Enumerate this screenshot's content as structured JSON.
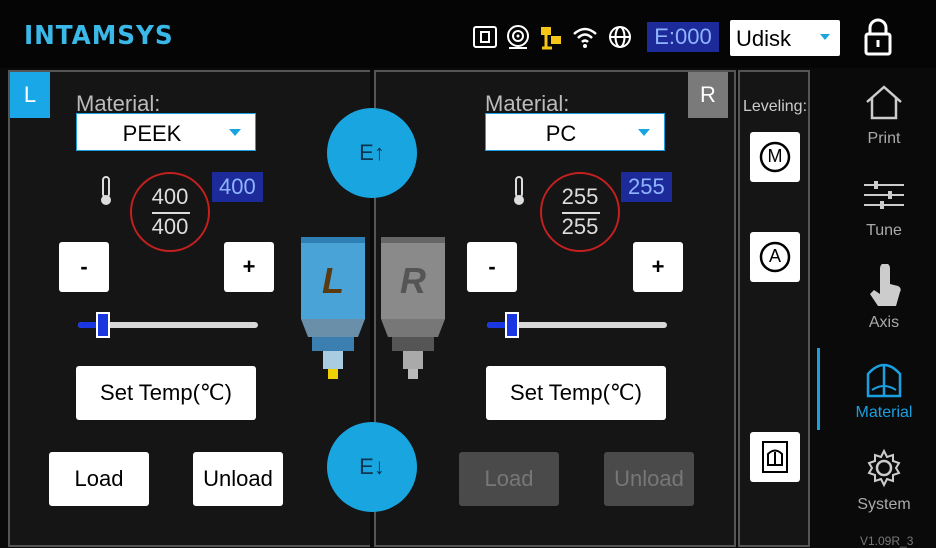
{
  "brand": {
    "logo": "INTAMSYS",
    "accent_color": "#1a9fe0"
  },
  "status_bar": {
    "icons": [
      "card-icon",
      "disc-icon",
      "network-icon",
      "wifi-icon",
      "globe-icon"
    ],
    "e_counter": "E:000",
    "storage_select": {
      "value": "Udisk"
    },
    "lock_icon": "lock-icon"
  },
  "left": {
    "tag": "L",
    "material_label": "Material:",
    "material_value": "PEEK",
    "temp_current": "400",
    "temp_target": "400",
    "temp_set": "400",
    "minus": "-",
    "plus": "+",
    "slider_value": 0.14,
    "set_temp_label": "Set Temp(℃)",
    "load_label": "Load",
    "unload_label": "Unload",
    "nozzle_letter": "L"
  },
  "right": {
    "tag": "R",
    "material_label": "Material:",
    "material_value": "PC",
    "temp_current": "255",
    "temp_target": "255",
    "temp_set": "255",
    "minus": "-",
    "plus": "+",
    "slider_value": 0.14,
    "set_temp_label": "Set Temp(℃)",
    "load_label": "Load",
    "unload_label": "Unload",
    "nozzle_letter": "R"
  },
  "extrude": {
    "up_label": "E↑",
    "down_label": "E↓"
  },
  "leveling": {
    "label": "Leveling:",
    "manual_letter": "M",
    "auto_letter": "A"
  },
  "nav": {
    "items": [
      {
        "label": "Print",
        "icon": "house-icon"
      },
      {
        "label": "Tune",
        "icon": "sliders-icon"
      },
      {
        "label": "Axis",
        "icon": "hand-icon"
      },
      {
        "label": "Material",
        "icon": "spool-icon",
        "active": true
      },
      {
        "label": "System",
        "icon": "gear-icon"
      }
    ]
  },
  "version": "V1.09R_3"
}
